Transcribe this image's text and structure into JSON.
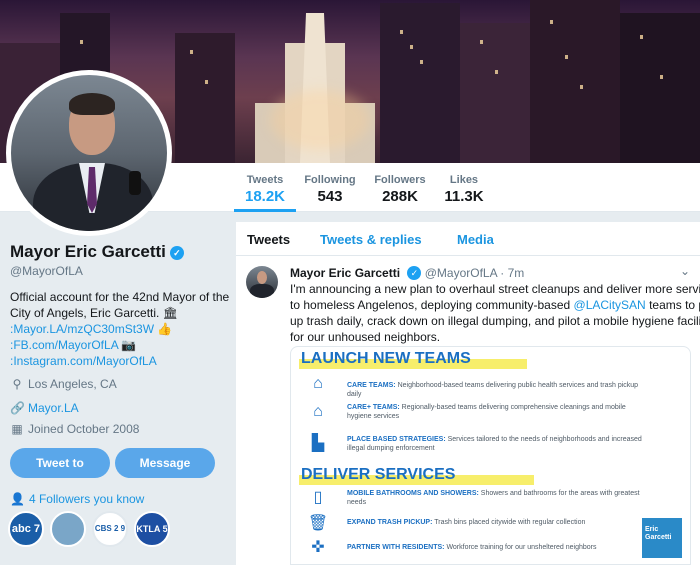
{
  "profile": {
    "name": "Mayor Eric Garcetti",
    "handle": "@MayorOfLA",
    "bio": {
      "line1": "Official account for the 42nd Mayor of the",
      "line2": "City of Angels, Eric Garcetti.",
      "link1": ":Mayor.LA/mzQC30mSt3W",
      "link2": ":FB.com/MayorOfLA",
      "link3": ":Instagram.com/MayorOfLA"
    },
    "location": "Los Angeles, CA",
    "website": "Mayor.LA",
    "joined": "Joined October 2008",
    "tweet_to_label": "Tweet to",
    "message_label": "Message",
    "followers_you_know": "4 Followers you know",
    "follower_avatars": [
      "abc 7",
      "antenna",
      "CBS 2 9",
      "KTLA 5"
    ]
  },
  "nav": {
    "stats": [
      {
        "label": "Tweets",
        "value": "18.2K"
      },
      {
        "label": "Following",
        "value": "543"
      },
      {
        "label": "Followers",
        "value": "288K"
      },
      {
        "label": "Likes",
        "value": "11.3K"
      }
    ]
  },
  "timeline": {
    "tabs": [
      "Tweets",
      "Tweets & replies",
      "Media"
    ],
    "tweet": {
      "name": "Mayor Eric Garcetti",
      "handle": "@MayorOfLA",
      "time": "· 7m",
      "text": {
        "l1": "I'm announcing a new plan to overhaul street cleanups and deliver more services",
        "l2": "to homeless Angelenos, deploying community-based",
        "mention": "@LACitySAN",
        "l2b": "teams to pick",
        "l3": "up trash daily, crack down on illegal dumping, and pilot a mobile hygiene facility",
        "l4": "for our unhoused neighbors."
      },
      "card": {
        "heading1": "LAUNCH NEW TEAMS",
        "items1": [
          {
            "title": "CARE TEAMS:",
            "desc": "Neighborhood-based teams delivering public health services and trash pickup daily"
          },
          {
            "title": "CARE+ TEAMS:",
            "desc": "Regionally-based teams delivering comprehensive cleanings and mobile hygiene services"
          },
          {
            "title": "PLACE BASED STRATEGIES:",
            "desc": "Services tailored to the needs of neighborhoods and increased illegal dumping enforcement"
          }
        ],
        "heading2": "DELIVER SERVICES",
        "items2": [
          {
            "title": "MOBILE BATHROOMS AND SHOWERS:",
            "desc": "Showers and bathrooms for the areas with greatest needs"
          },
          {
            "title": "EXPAND TRASH PICKUP:",
            "desc": "Trash bins placed citywide with regular collection"
          },
          {
            "title": "PARTNER WITH RESIDENTS:",
            "desc": "Workforce training for our unsheltered neighbors"
          }
        ],
        "logo_line1": "Eric",
        "logo_line2": "Garcetti"
      }
    }
  },
  "colors": {
    "accent": "#1da1f2",
    "link": "#1b95e0",
    "button": "#5aa7ea"
  }
}
